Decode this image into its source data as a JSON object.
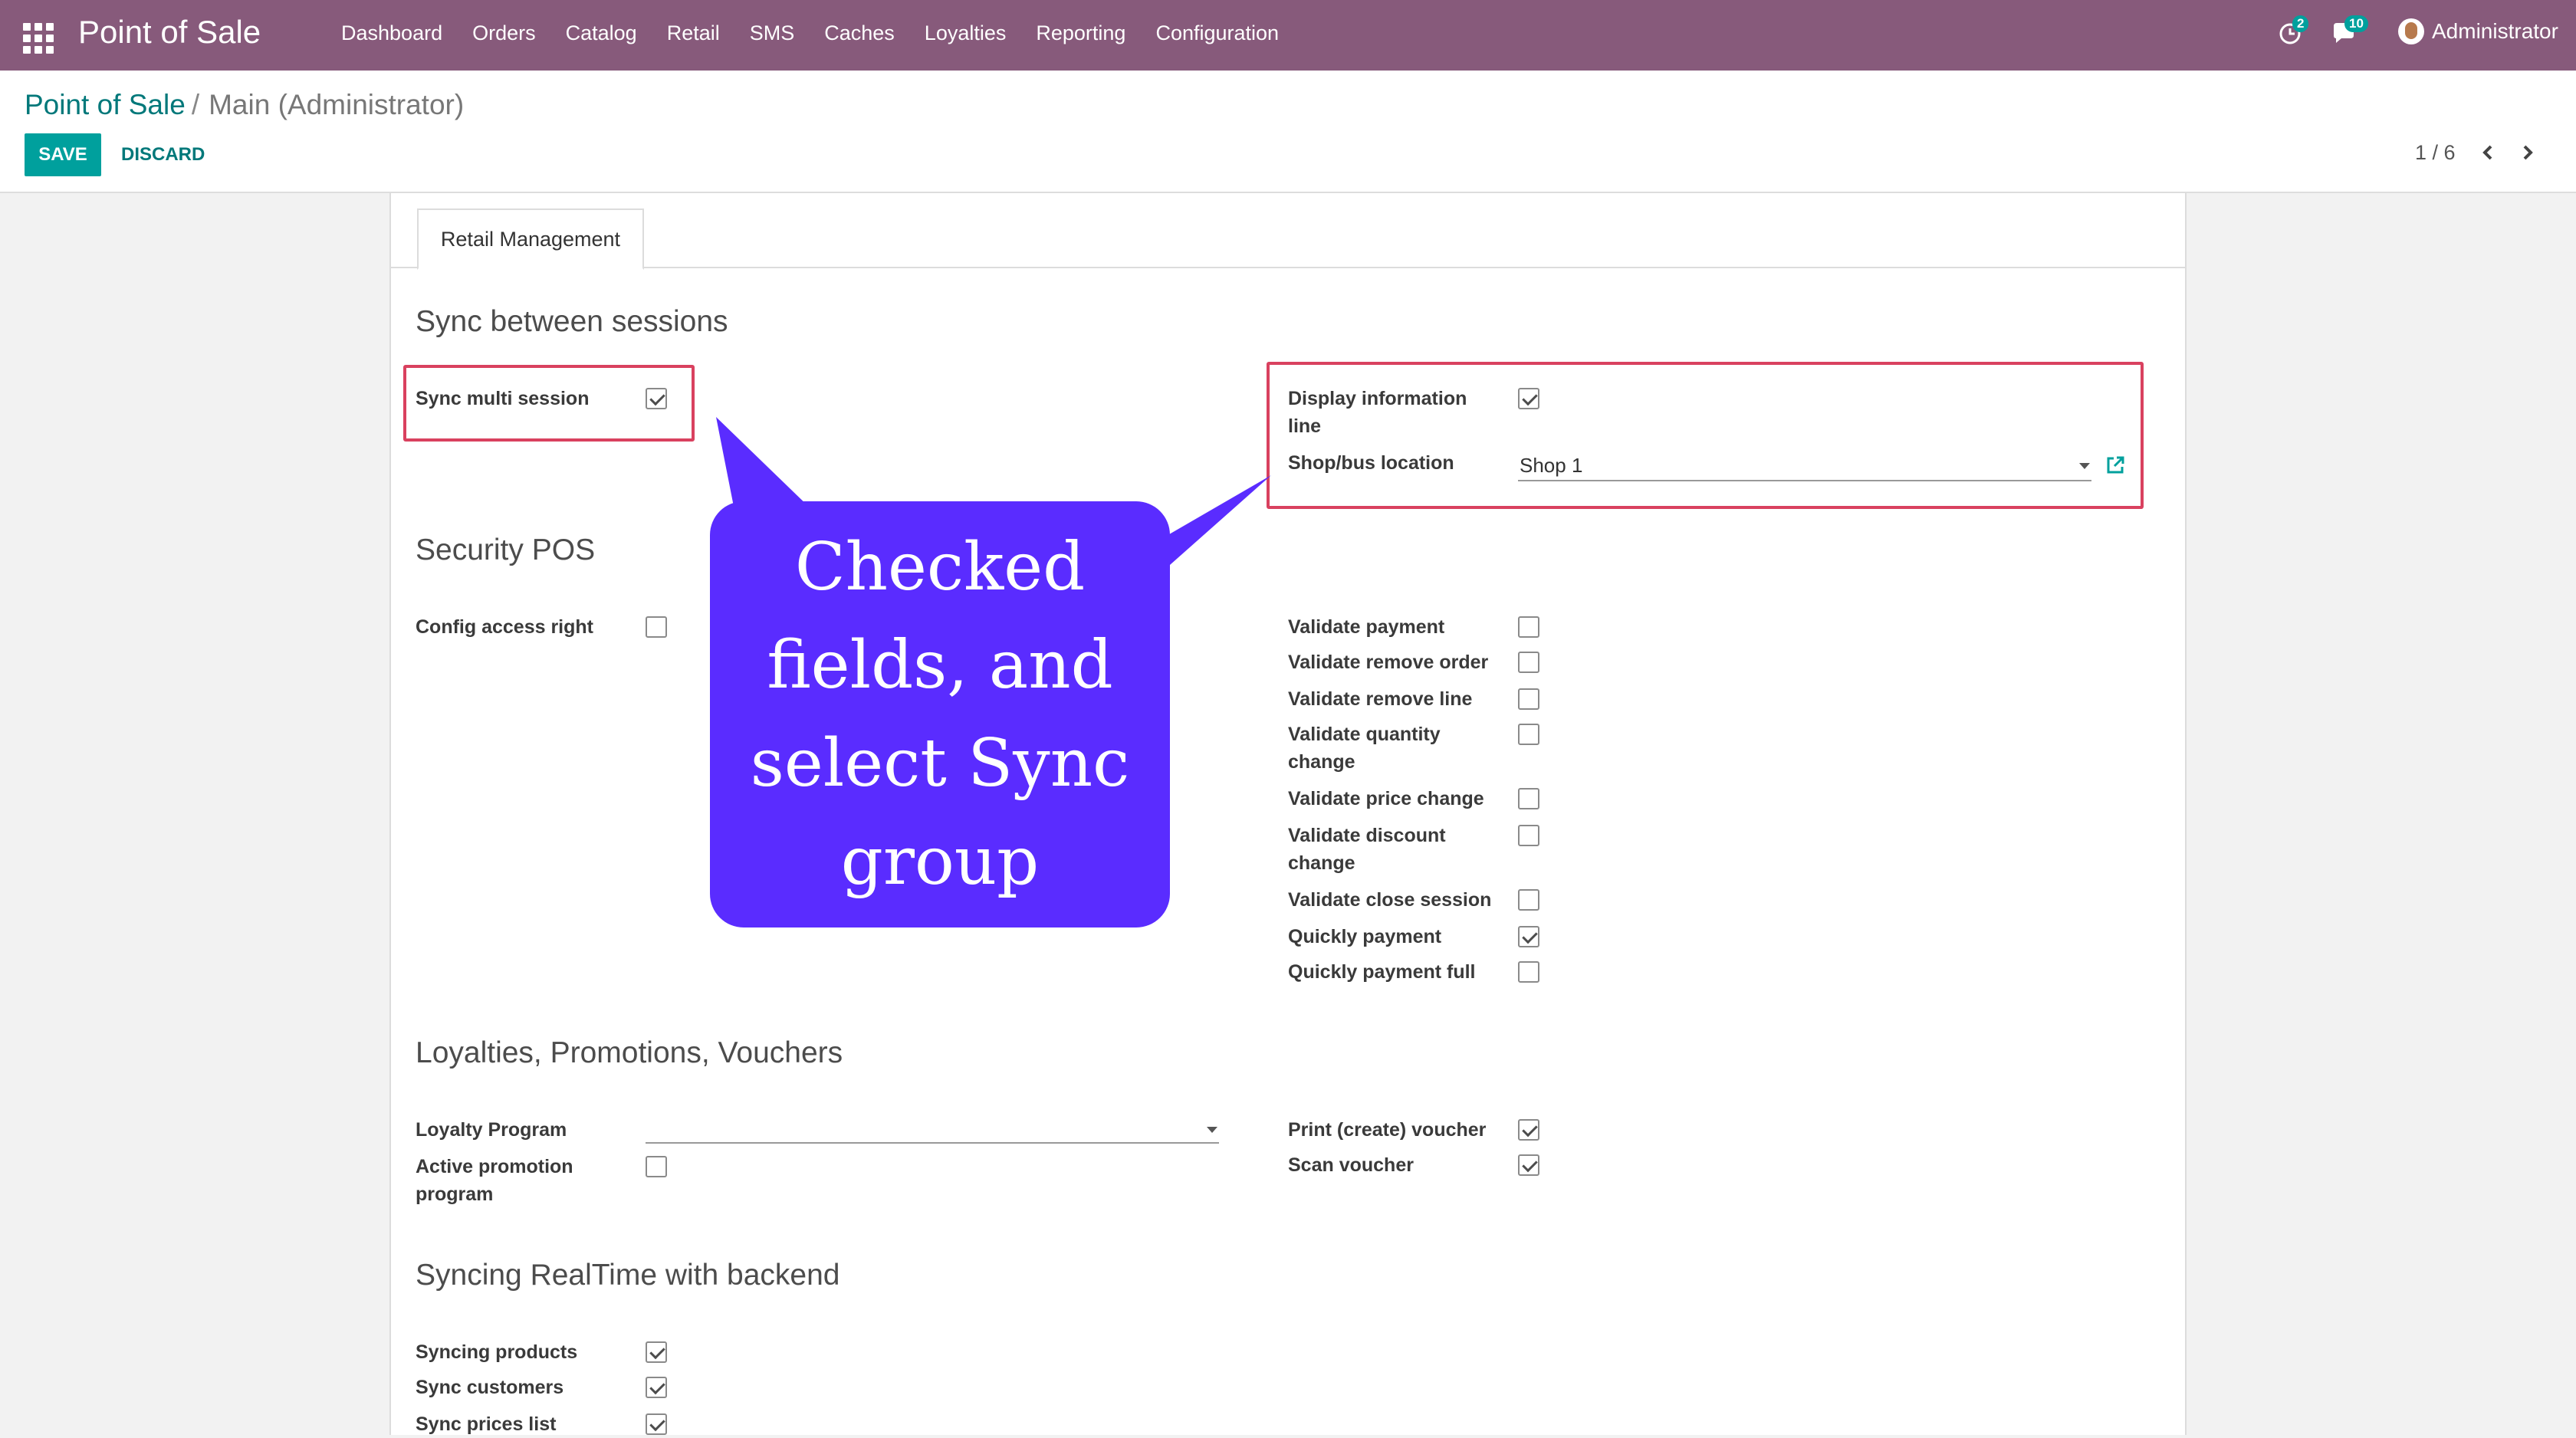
{
  "navbar": {
    "app_title": "Point of Sale",
    "menu": [
      "Dashboard",
      "Orders",
      "Catalog",
      "Retail",
      "SMS",
      "Caches",
      "Loyalties",
      "Reporting",
      "Configuration"
    ],
    "activity_count": "2",
    "messages_count": "10",
    "user": "Administrator",
    "color": "#875a7b"
  },
  "breadcrumb": {
    "parent": "Point of Sale",
    "separator": "/",
    "current": "Main (Administrator)"
  },
  "actions": {
    "save": "SAVE",
    "discard": "DISCARD"
  },
  "pager": {
    "text": "1 / 6"
  },
  "tabs": [
    "Retail Management"
  ],
  "sync_sessions": {
    "title": "Sync between sessions",
    "sync_multi_session": {
      "label": "Sync multi session",
      "checked": true
    },
    "display_information_line": {
      "label_line1": "Display information",
      "label_line2": "line",
      "checked": true
    },
    "shop_bus_location": {
      "label": "Shop/bus location",
      "value": "Shop 1"
    }
  },
  "security": {
    "title": "Security POS",
    "config_access_right": {
      "label": "Config access right",
      "checked": false
    },
    "right_fields": [
      {
        "label": "Validate payment",
        "checked": false
      },
      {
        "label": "Validate remove order",
        "checked": false
      },
      {
        "label": "Validate remove line",
        "checked": false
      },
      {
        "label": "Validate quantity",
        "label2": "change",
        "checked": false
      },
      {
        "label": "Validate price change",
        "checked": false
      },
      {
        "label": "Validate discount",
        "label2": "change",
        "checked": false
      },
      {
        "label": "Validate close session",
        "checked": false
      },
      {
        "label": "Quickly payment",
        "checked": true
      },
      {
        "label": "Quickly payment full",
        "checked": false
      }
    ]
  },
  "loyalties": {
    "title": "Loyalties, Promotions, Vouchers",
    "loyalty_program": {
      "label": "Loyalty Program",
      "value": ""
    },
    "active_promotion": {
      "label_line1": "Active promotion",
      "label_line2": "program",
      "checked": false
    },
    "print_voucher": {
      "label": "Print (create) voucher",
      "checked": true
    },
    "scan_voucher": {
      "label": "Scan voucher",
      "checked": true
    }
  },
  "realtime": {
    "title": "Syncing RealTime with backend",
    "fields": [
      {
        "label": "Syncing products",
        "checked": true
      },
      {
        "label": "Sync customers",
        "checked": true
      },
      {
        "label": "Sync prices list",
        "checked": true
      }
    ]
  },
  "annotation": {
    "lines": [
      "Checked",
      "fields, and",
      "select Sync",
      "group"
    ],
    "bubble_color": "#5a2cff",
    "highlight_color": "#d9415f"
  }
}
